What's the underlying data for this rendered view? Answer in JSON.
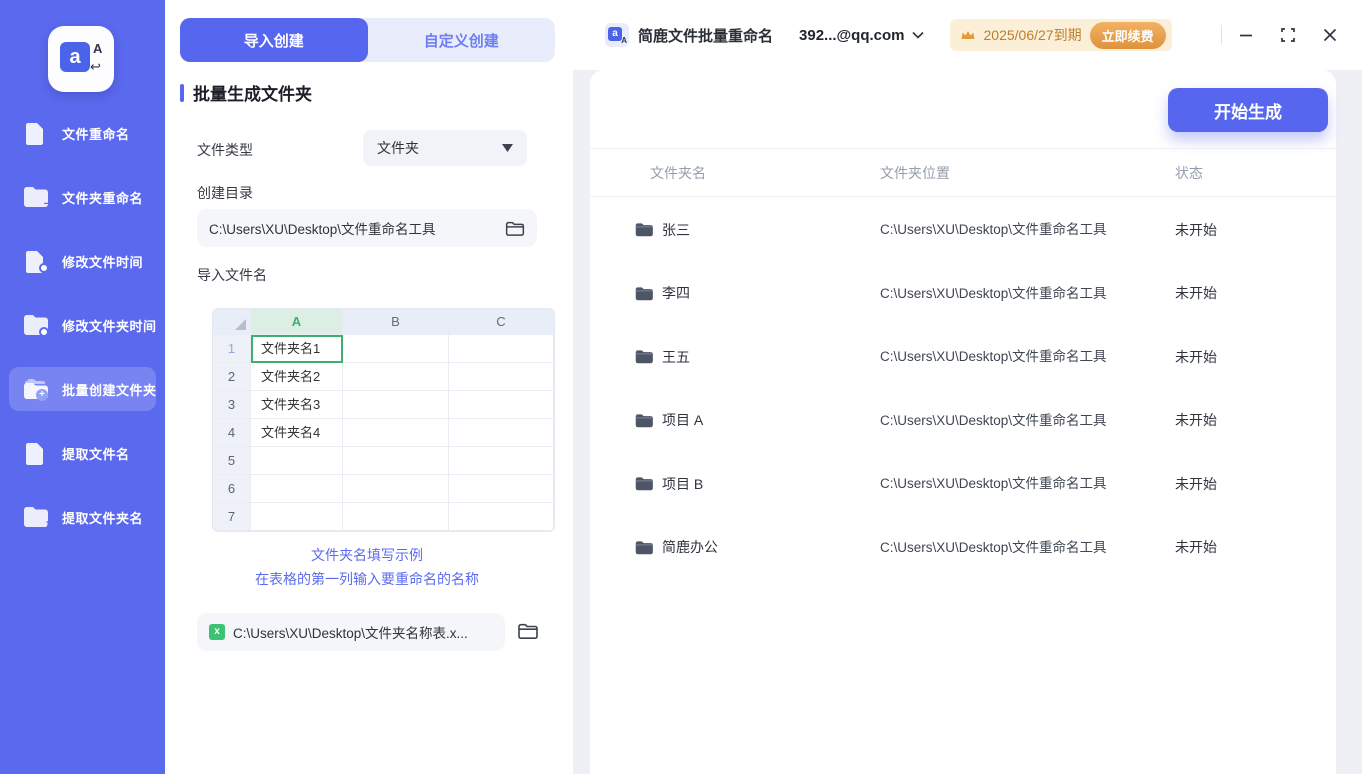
{
  "colors": {
    "accent": "#5766ee",
    "sidebar_bg": "#5b69ee",
    "sheet_green": "#3fae6e",
    "excel_green": "#3bc272",
    "badge_bg": "#fbf0d7",
    "badge_text": "#bb7f2d",
    "renew_orange": "#df923c"
  },
  "sidebar": {
    "logo": {
      "letter_main": "a",
      "letter_sub": "A",
      "arrow": "↩"
    },
    "items": [
      {
        "label": "文件重命名"
      },
      {
        "label": "文件夹重命名"
      },
      {
        "label": "修改文件时间"
      },
      {
        "label": "修改文件夹时间"
      },
      {
        "label": "批量创建文件夹"
      },
      {
        "label": "提取文件名"
      },
      {
        "label": "提取文件夹名"
      }
    ]
  },
  "panel": {
    "tabs": [
      {
        "label": "导入创建"
      },
      {
        "label": "自定义创建"
      }
    ],
    "section_title": "批量生成文件夹",
    "file_type": {
      "label": "文件类型",
      "value": "文件夹"
    },
    "create_dir": {
      "label": "创建目录",
      "value": "C:\\Users\\XU\\Desktop\\文件重命名工具"
    },
    "import_names_label": "导入文件名",
    "sheet": {
      "columns": [
        "A",
        "B",
        "C"
      ],
      "row_numbers": [
        "1",
        "2",
        "3",
        "4",
        "5",
        "6",
        "7"
      ],
      "cells_a": [
        "文件夹名1",
        "文件夹名2",
        "文件夹名3",
        "文件夹名4",
        "",
        "",
        ""
      ]
    },
    "hint_line1": "文件夹名填写示例",
    "hint_line2": "在表格的第一列输入要重命名的名称",
    "excel_icon_letter": "x",
    "excel_path": "C:\\Users\\XU\\Desktop\\文件夹名称表.x..."
  },
  "topbar": {
    "title": "简鹿文件批量重命名",
    "account": "392...@qq.com",
    "expiry": "2025/06/27到期",
    "renew_label": "立即续费"
  },
  "main": {
    "generate_label": "开始生成",
    "table": {
      "headers": [
        "文件夹名",
        "文件夹位置",
        "状态"
      ],
      "rows": [
        {
          "name": "张三",
          "location": "C:\\Users\\XU\\Desktop\\文件重命名工具",
          "status": "未开始"
        },
        {
          "name": "李四",
          "location": "C:\\Users\\XU\\Desktop\\文件重命名工具",
          "status": "未开始"
        },
        {
          "name": "王五",
          "location": "C:\\Users\\XU\\Desktop\\文件重命名工具",
          "status": "未开始"
        },
        {
          "name": "项目 A",
          "location": "C:\\Users\\XU\\Desktop\\文件重命名工具",
          "status": "未开始"
        },
        {
          "name": "项目 B",
          "location": "C:\\Users\\XU\\Desktop\\文件重命名工具",
          "status": "未开始"
        },
        {
          "name": "简鹿办公",
          "location": "C:\\Users\\XU\\Desktop\\文件重命名工具",
          "status": "未开始"
        }
      ]
    }
  }
}
